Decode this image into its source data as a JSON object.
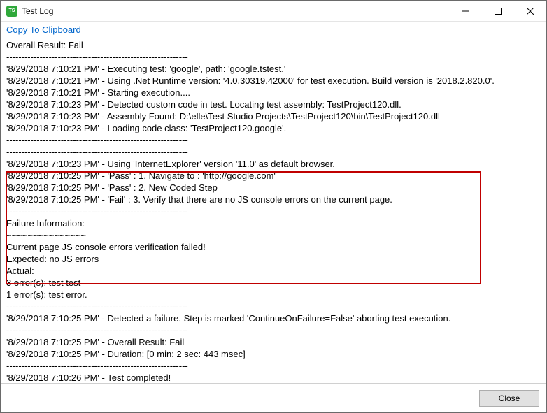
{
  "titlebar": {
    "title": "Test Log"
  },
  "toolbar": {
    "copy_label": "Copy To Clipboard"
  },
  "log": {
    "lines": [
      "Overall Result: Fail",
      "------------------------------------------------------------",
      "'8/29/2018 7:10:21 PM' - Executing test: 'google', path: 'google.tstest.'",
      "'8/29/2018 7:10:21 PM' - Using .Net Runtime version: '4.0.30319.42000' for test execution. Build version is '2018.2.820.0'.",
      "'8/29/2018 7:10:21 PM' - Starting execution....",
      "'8/29/2018 7:10:23 PM' - Detected custom code in test. Locating test assembly: TestProject120.dll.",
      "'8/29/2018 7:10:23 PM' - Assembly Found: D:\\elle\\Test Studio Projects\\TestProject120\\bin\\TestProject120.dll",
      "'8/29/2018 7:10:23 PM' - Loading code class: 'TestProject120.google'.",
      "------------------------------------------------------------",
      "------------------------------------------------------------",
      "'8/29/2018 7:10:23 PM' - Using 'InternetExplorer' version '11.0' as default browser.",
      "'8/29/2018 7:10:25 PM' - 'Pass' : 1. Navigate to : 'http://google.com'",
      "'8/29/2018 7:10:25 PM' - 'Pass' : 2. New Coded Step",
      "'8/29/2018 7:10:25 PM' - 'Fail' : 3. Verify that there are no JS console errors on the current page.",
      "------------------------------------------------------------",
      "Failure Information:",
      "~~~~~~~~~~~~~~~",
      "Current page JS console errors verification failed!",
      "  Expected: no JS errors",
      "  Actual:",
      "3 error(s): test test",
      "1 error(s): test error.",
      "------------------------------------------------------------",
      "'8/29/2018 7:10:25 PM' - Detected a failure. Step is marked 'ContinueOnFailure=False' aborting test execution.",
      "------------------------------------------------------------",
      "'8/29/2018 7:10:25 PM' - Overall Result: Fail",
      "'8/29/2018 7:10:25 PM' - Duration: [0 min: 2 sec: 443 msec]",
      "------------------------------------------------------------",
      "'8/29/2018 7:10:26 PM' - Test completed!"
    ]
  },
  "footer": {
    "close_label": "Close"
  }
}
